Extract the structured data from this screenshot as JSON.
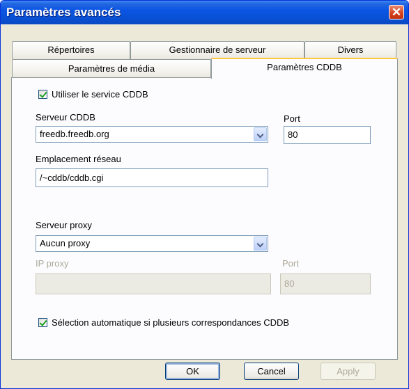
{
  "window": {
    "title": "Paramètres avancés",
    "close_glyph": "✕"
  },
  "tabs": {
    "row_back": [
      {
        "label": "Répertoires"
      },
      {
        "label": "Gestionnaire de serveur"
      },
      {
        "label": "Divers"
      }
    ],
    "row_front": [
      {
        "label": "Paramètres de média"
      },
      {
        "label": "Paramètres CDDB"
      }
    ],
    "active": "Paramètres CDDB"
  },
  "cddb": {
    "use_service": {
      "label": "Utiliser le service CDDB",
      "checked": true
    },
    "server_label": "Serveur CDDB",
    "server_value": "freedb.freedb.org",
    "port_label": "Port",
    "port_value": "80",
    "location_label": "Emplacement réseau",
    "location_value": "/~cddb/cddb.cgi"
  },
  "proxy": {
    "server_label": "Serveur proxy",
    "server_value": "Aucun proxy",
    "ip_label": "IP proxy",
    "ip_value": "",
    "port_label": "Port",
    "port_value": "80"
  },
  "auto_select": {
    "label": "Sélection automatique si plusieurs correspondances CDDB",
    "checked": true
  },
  "buttons": {
    "ok": "OK",
    "cancel": "Cancel",
    "apply": "Apply"
  },
  "colors": {
    "titlebar": "#0a55e4",
    "dialog_bg": "#ece9d8",
    "active_tab_accent": "#ffc83c",
    "disabled_text": "#aca899"
  }
}
